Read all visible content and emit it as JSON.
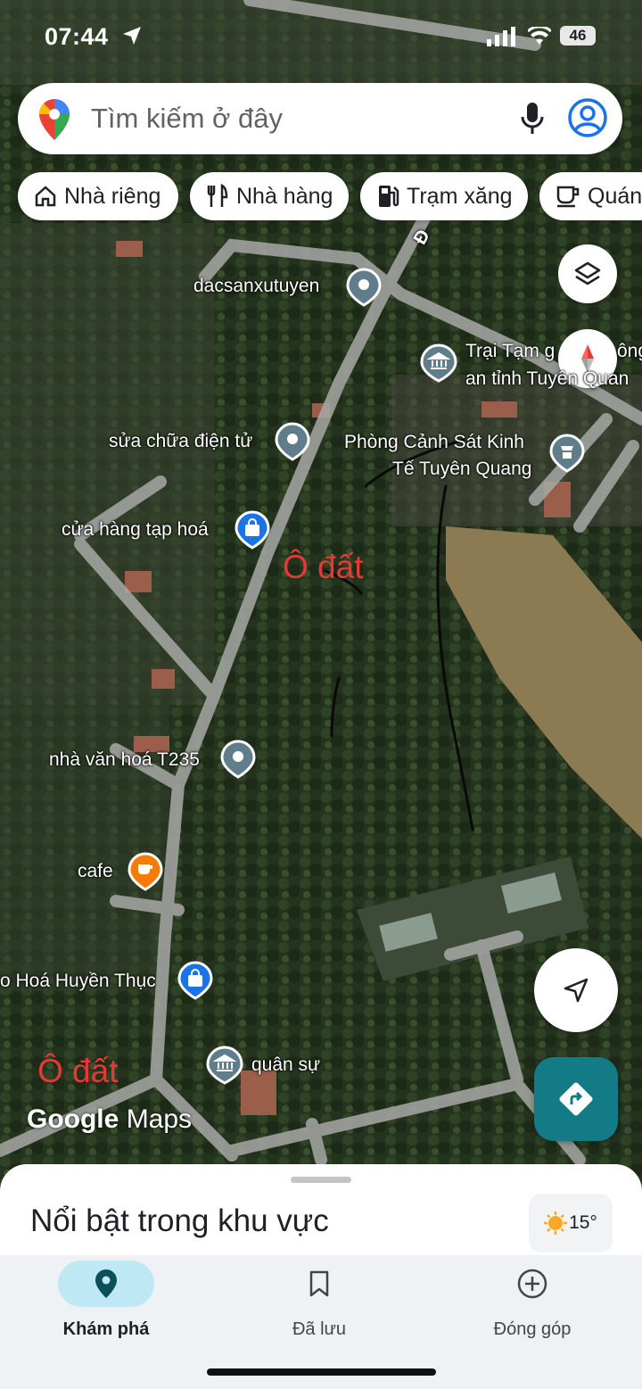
{
  "status_bar": {
    "time": "07:44",
    "battery": "46"
  },
  "search": {
    "placeholder": "Tìm kiếm ở đây"
  },
  "chips": [
    {
      "label": "Nhà riêng",
      "icon": "home-icon"
    },
    {
      "label": "Nhà hàng",
      "icon": "restaurant-icon"
    },
    {
      "label": "Trạm xăng",
      "icon": "gas-station-icon"
    },
    {
      "label": "Quán",
      "icon": "cafe-icon"
    }
  ],
  "map": {
    "labels": {
      "road": "Đ",
      "dacsan": "dacsanxutuyen",
      "trai_tam_1": "Trại Tạm g",
      "trai_tam_1b": "ông",
      "trai_tam_2": "an tỉnh Tuyên Quan",
      "sua_chua": "sửa chữa điện tử",
      "phong_canh_sat_1": "Phòng Cảnh Sát Kinh",
      "phong_canh_sat_2": "Tế Tuyên Quang",
      "tap_hoa": "cửa hàng tạp hoá",
      "nha_van_hoa": "nhà văn hoá T235",
      "cafe": "cafe",
      "huyen_thuc": "o Hoá Huyền Thục",
      "quan_su": "quân sự"
    },
    "annotations": [
      "Ô đất",
      "Ô đất"
    ],
    "brand": {
      "google": "Google",
      "maps": "Maps"
    }
  },
  "sheet": {
    "title": "Nổi bật trong khu vực",
    "temperature": "15°"
  },
  "nav": {
    "explore": "Khám phá",
    "saved": "Đã lưu",
    "contribute": "Đóng góp"
  },
  "colors": {
    "accent_teal": "#127b86",
    "nav_pill": "#bfe8f5",
    "annotation_red": "#e53935",
    "poi_blue": "#1a73e8",
    "poi_orange": "#f57c00",
    "poi_grey": "#607d8b"
  }
}
